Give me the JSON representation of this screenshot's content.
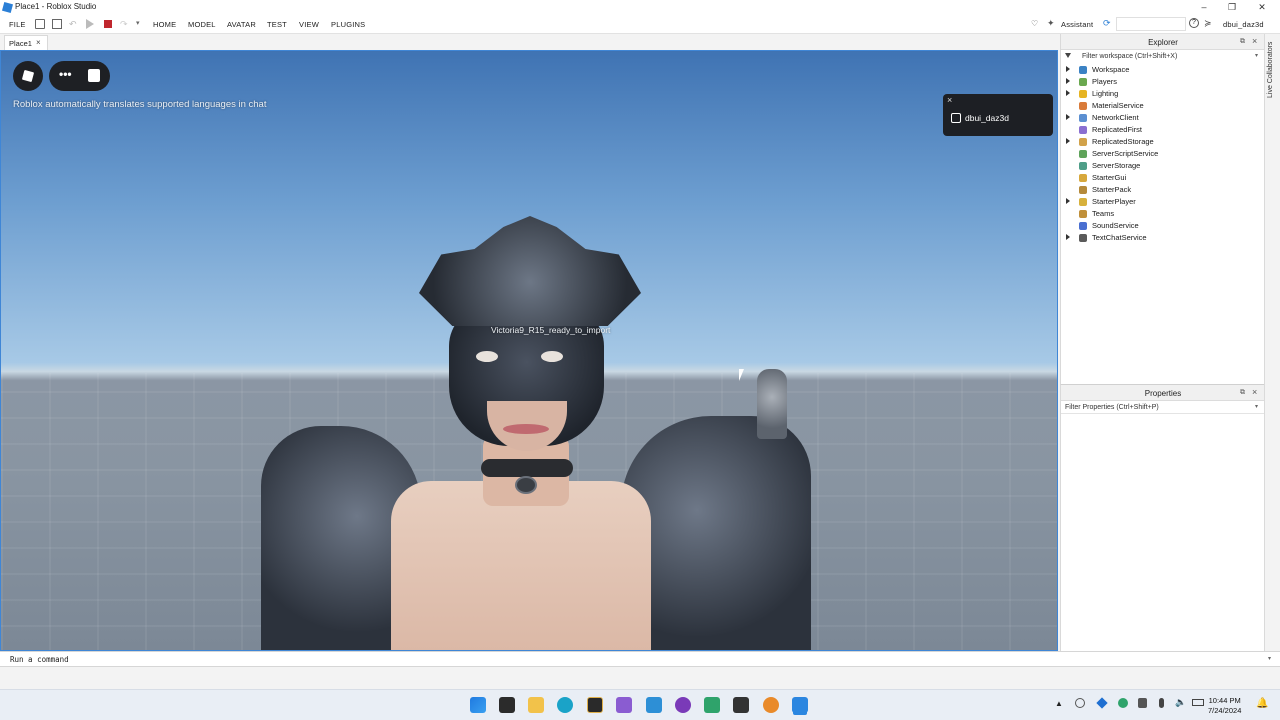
{
  "window": {
    "title": "Place1 - Roblox Studio",
    "controls": [
      "minimize",
      "maximize",
      "close"
    ]
  },
  "menubar": {
    "items": [
      "FILE",
      "HOME",
      "MODEL",
      "AVATAR",
      "TEST",
      "VIEW",
      "PLUGINS"
    ],
    "assistant_label": "Assistant",
    "username": "dbui_daz3d"
  },
  "tabs": [
    {
      "label": "Place1"
    }
  ],
  "viewport": {
    "chat_notice": "Roblox automatically translates supported languages in chat",
    "player_name": "dbui_daz3d",
    "character_label": "Victoria9_R15_ready_to_import"
  },
  "explorer": {
    "title": "Explorer",
    "filter_placeholder": "Filter workspace (Ctrl+Shift+X)",
    "items": [
      {
        "label": "Workspace",
        "expandable": true,
        "icon": "globe-icon",
        "color": "#3b82c4"
      },
      {
        "label": "Players",
        "expandable": true,
        "icon": "players-icon",
        "color": "#6aa84f"
      },
      {
        "label": "Lighting",
        "expandable": true,
        "icon": "lightbulb-icon",
        "color": "#e6b422"
      },
      {
        "label": "MaterialService",
        "expandable": false,
        "icon": "material-icon",
        "color": "#d97b3a"
      },
      {
        "label": "NetworkClient",
        "expandable": true,
        "icon": "network-icon",
        "color": "#5b8fd1"
      },
      {
        "label": "ReplicatedFirst",
        "expandable": false,
        "icon": "replicated-first-icon",
        "color": "#8a6fd1"
      },
      {
        "label": "ReplicatedStorage",
        "expandable": true,
        "icon": "replicated-storage-icon",
        "color": "#d1a24a"
      },
      {
        "label": "ServerScriptService",
        "expandable": false,
        "icon": "server-script-icon",
        "color": "#5fa35a"
      },
      {
        "label": "ServerStorage",
        "expandable": false,
        "icon": "server-storage-icon",
        "color": "#4f9e88"
      },
      {
        "label": "StarterGui",
        "expandable": false,
        "icon": "starter-gui-icon",
        "color": "#d7a83c"
      },
      {
        "label": "StarterPack",
        "expandable": false,
        "icon": "starter-pack-icon",
        "color": "#b58a3a"
      },
      {
        "label": "StarterPlayer",
        "expandable": true,
        "icon": "starter-player-icon",
        "color": "#d7b13c"
      },
      {
        "label": "Teams",
        "expandable": false,
        "icon": "teams-icon",
        "color": "#c0903a"
      },
      {
        "label": "SoundService",
        "expandable": false,
        "icon": "sound-icon",
        "color": "#4a6fd1"
      },
      {
        "label": "TextChatService",
        "expandable": true,
        "icon": "text-chat-icon",
        "color": "#5a5a5a"
      }
    ]
  },
  "properties": {
    "title": "Properties",
    "filter_placeholder": "Filter Properties (Ctrl+Shift+P)"
  },
  "collab": {
    "label": "Live Collaborators"
  },
  "command_bar": {
    "placeholder": "Run a command"
  },
  "taskbar": {
    "apps": [
      "start-icon",
      "app-icon",
      "folder-icon",
      "edge-icon",
      "daz-icon",
      "visual-studio-icon",
      "vscode-icon",
      "app-icon",
      "app-icon",
      "terminal-icon",
      "blender-icon",
      "roblox-studio-icon"
    ],
    "time": "10:44 PM",
    "date": "7/24/2024"
  }
}
